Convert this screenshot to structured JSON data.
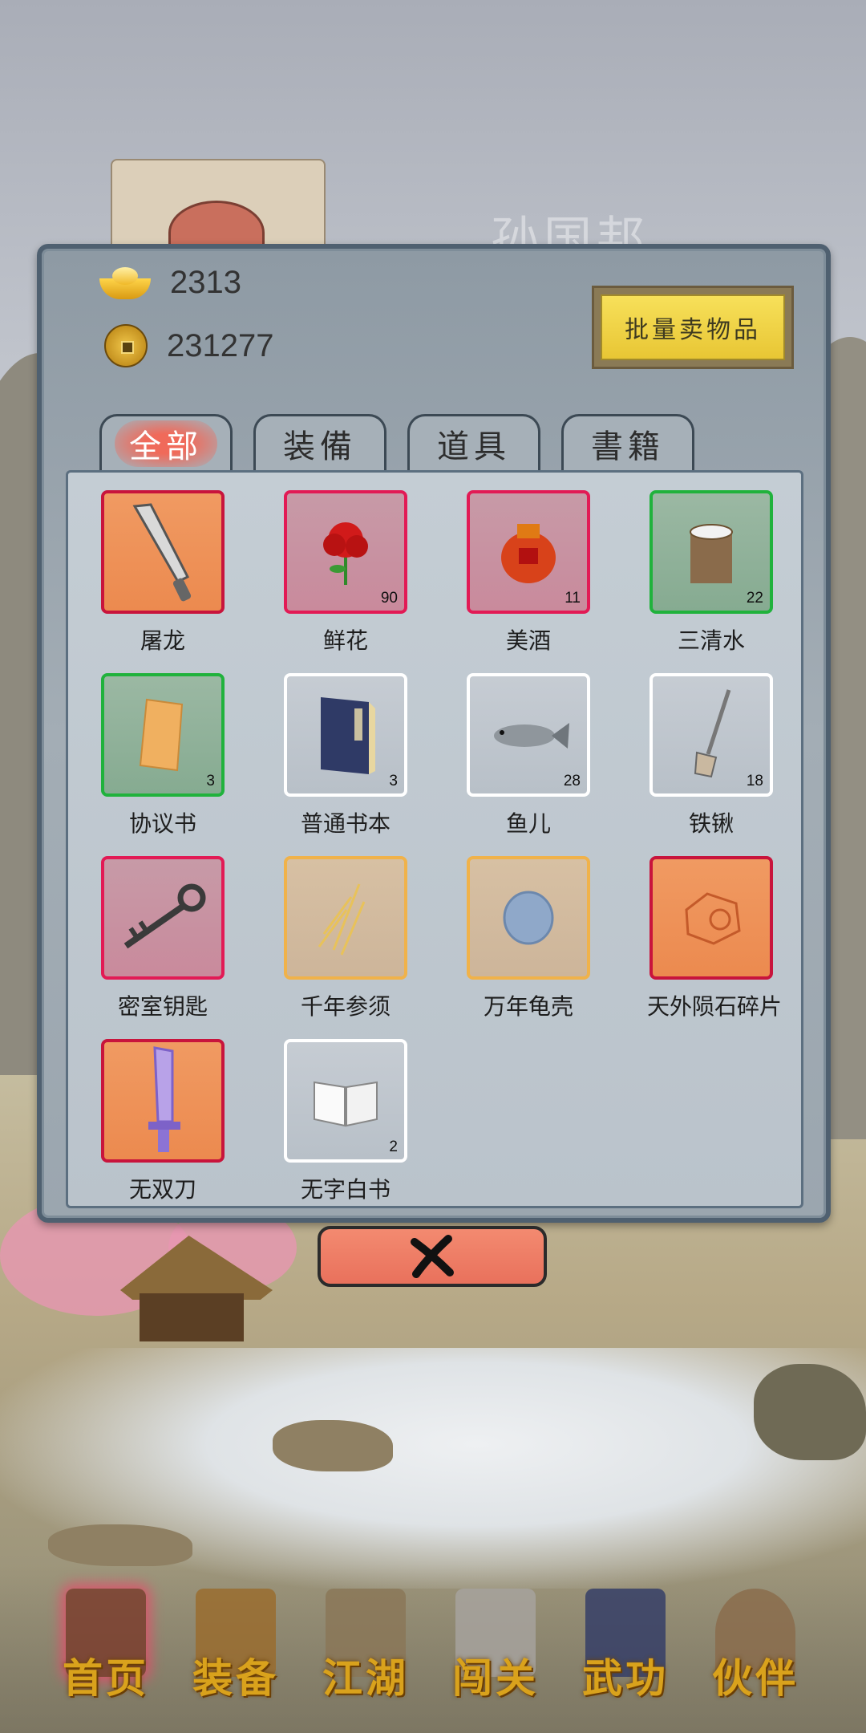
{
  "background": {
    "ghost_name": "孙国邦"
  },
  "currency": {
    "ingot": "2313",
    "coin": "231277"
  },
  "bulk_sell_label": "批量卖物品",
  "tabs": [
    {
      "label": "全部",
      "active": true
    },
    {
      "label": "装備",
      "active": false
    },
    {
      "label": "道具",
      "active": false
    },
    {
      "label": "書籍",
      "active": false
    }
  ],
  "items": [
    {
      "name": "屠龙",
      "count": "",
      "frame": "orange",
      "icon": "saber-icon"
    },
    {
      "name": "鲜花",
      "count": "90",
      "frame": "red",
      "icon": "rose-icon"
    },
    {
      "name": "美酒",
      "count": "11",
      "frame": "red",
      "icon": "wine-jar-icon"
    },
    {
      "name": "三清水",
      "count": "22",
      "frame": "green",
      "icon": "water-bucket-icon"
    },
    {
      "name": "协议书",
      "count": "3",
      "frame": "green",
      "icon": "contract-icon"
    },
    {
      "name": "普通书本",
      "count": "3",
      "frame": "white",
      "icon": "book-icon"
    },
    {
      "name": "鱼儿",
      "count": "28",
      "frame": "white",
      "icon": "fish-icon"
    },
    {
      "name": "铁锹",
      "count": "18",
      "frame": "white",
      "icon": "shovel-icon"
    },
    {
      "name": "密室钥匙",
      "count": "",
      "frame": "red",
      "icon": "key-icon"
    },
    {
      "name": "千年参须",
      "count": "",
      "frame": "gold",
      "icon": "ginseng-icon"
    },
    {
      "name": "万年龟壳",
      "count": "",
      "frame": "gold",
      "icon": "turtle-shell-icon"
    },
    {
      "name": "天外陨石碎片",
      "count": "",
      "frame": "orange",
      "icon": "meteorite-icon"
    },
    {
      "name": "无双刀",
      "count": "",
      "frame": "orange",
      "icon": "purple-blade-icon"
    },
    {
      "name": "无字白书",
      "count": "2",
      "frame": "white",
      "icon": "blank-book-icon"
    }
  ],
  "close_icon": "close-x-icon",
  "nav": [
    {
      "label": "首页",
      "icon": "home-icon",
      "active": true
    },
    {
      "label": "装备",
      "icon": "armor-icon",
      "active": false
    },
    {
      "label": "江湖",
      "icon": "scroll-icon",
      "active": false
    },
    {
      "label": "闯关",
      "icon": "crossed-swords-icon",
      "active": false
    },
    {
      "label": "武功",
      "icon": "martial-book-icon",
      "active": false
    },
    {
      "label": "伙伴",
      "icon": "partners-icon",
      "active": false
    }
  ],
  "colors": {
    "frame_red": "#e21a55",
    "frame_green": "#20b23c",
    "frame_gold": "#f0b24a",
    "frame_orange_fill": "#ec8a4f",
    "bulk_button": "#e8c634",
    "close_button": "#e9715c",
    "nav_label": "#d9a21c"
  }
}
